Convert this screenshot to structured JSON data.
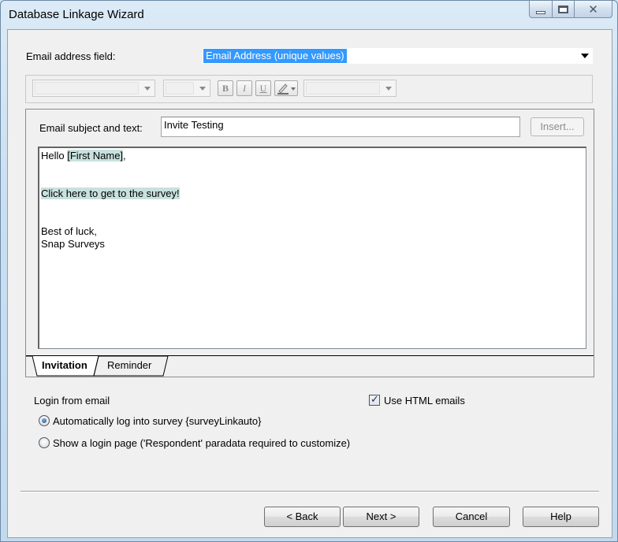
{
  "window": {
    "title": "Database Linkage Wizard"
  },
  "email_field": {
    "label": "Email address field:",
    "value": "Email Address (unique values)"
  },
  "editor": {
    "subject_label": "Email subject and text:",
    "subject_value": "Invite Testing",
    "insert_button": "Insert...",
    "format_buttons": {
      "bold": "B",
      "italic": "I",
      "underline": "U"
    },
    "body": {
      "greeting_prefix": "Hello ",
      "greeting_field": "[First Name]",
      "greeting_suffix": ",",
      "link_text": "Click here to get to the survey!",
      "closing": "Best of luck,",
      "signature": "Snap Surveys"
    },
    "tabs": [
      {
        "label": "Invitation",
        "active": true
      },
      {
        "label": "Reminder",
        "active": false
      }
    ]
  },
  "login": {
    "label": "Login from email",
    "option_auto": "Automatically log into survey {surveyLinkauto}",
    "option_page": "Show a login page ('Respondent' paradata required to customize)",
    "selected": "auto"
  },
  "html_emails": {
    "label": "Use HTML emails",
    "checked": true
  },
  "buttons": {
    "back": "< Back",
    "next": "Next >",
    "cancel": "Cancel",
    "help": "Help"
  },
  "colors": {
    "selection": "#3399ff",
    "field_highlight": "#c8e1de",
    "dialog_bg": "#f0f0f0"
  }
}
